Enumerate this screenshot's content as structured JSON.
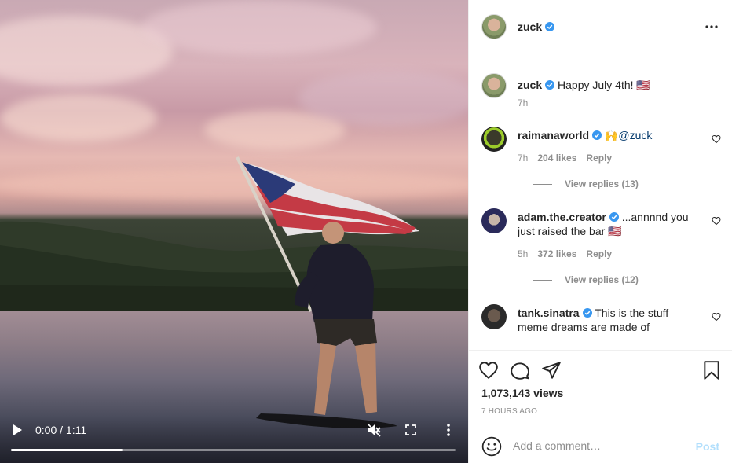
{
  "video": {
    "time": "0:00 / 1:11",
    "progress_fraction": 0.25,
    "icons": {
      "play": "play-icon",
      "mute": "muted-speaker-icon",
      "fullscreen": "fullscreen-icon",
      "more": "more-vertical-icon"
    }
  },
  "header": {
    "username": "zuck"
  },
  "caption": {
    "username": "zuck",
    "text": "Happy July 4th! 🇺🇸",
    "time": "7h"
  },
  "comments": [
    {
      "username": "raimanaworld",
      "emoji": "🙌",
      "mention": "@zuck",
      "time": "7h",
      "likes": "204 likes",
      "reply": "Reply",
      "view_replies": "View replies (13)"
    },
    {
      "username": "adam.the.creator",
      "text": "...annnnd you just raised the bar 🇺🇸",
      "time": "5h",
      "likes": "372 likes",
      "reply": "Reply",
      "view_replies": "View replies (12)"
    },
    {
      "username": "tank.sinatra",
      "text": "This is the stuff meme dreams are made of"
    }
  ],
  "actions": {
    "views": "1,073,143 views",
    "posted": "7 HOURS AGO"
  },
  "add_comment": {
    "placeholder": "Add a comment…",
    "post_label": "Post"
  },
  "colors": {
    "verified": "#3897f0",
    "post_disabled": "#b2dffc",
    "muted_text": "#8e8e8e"
  }
}
